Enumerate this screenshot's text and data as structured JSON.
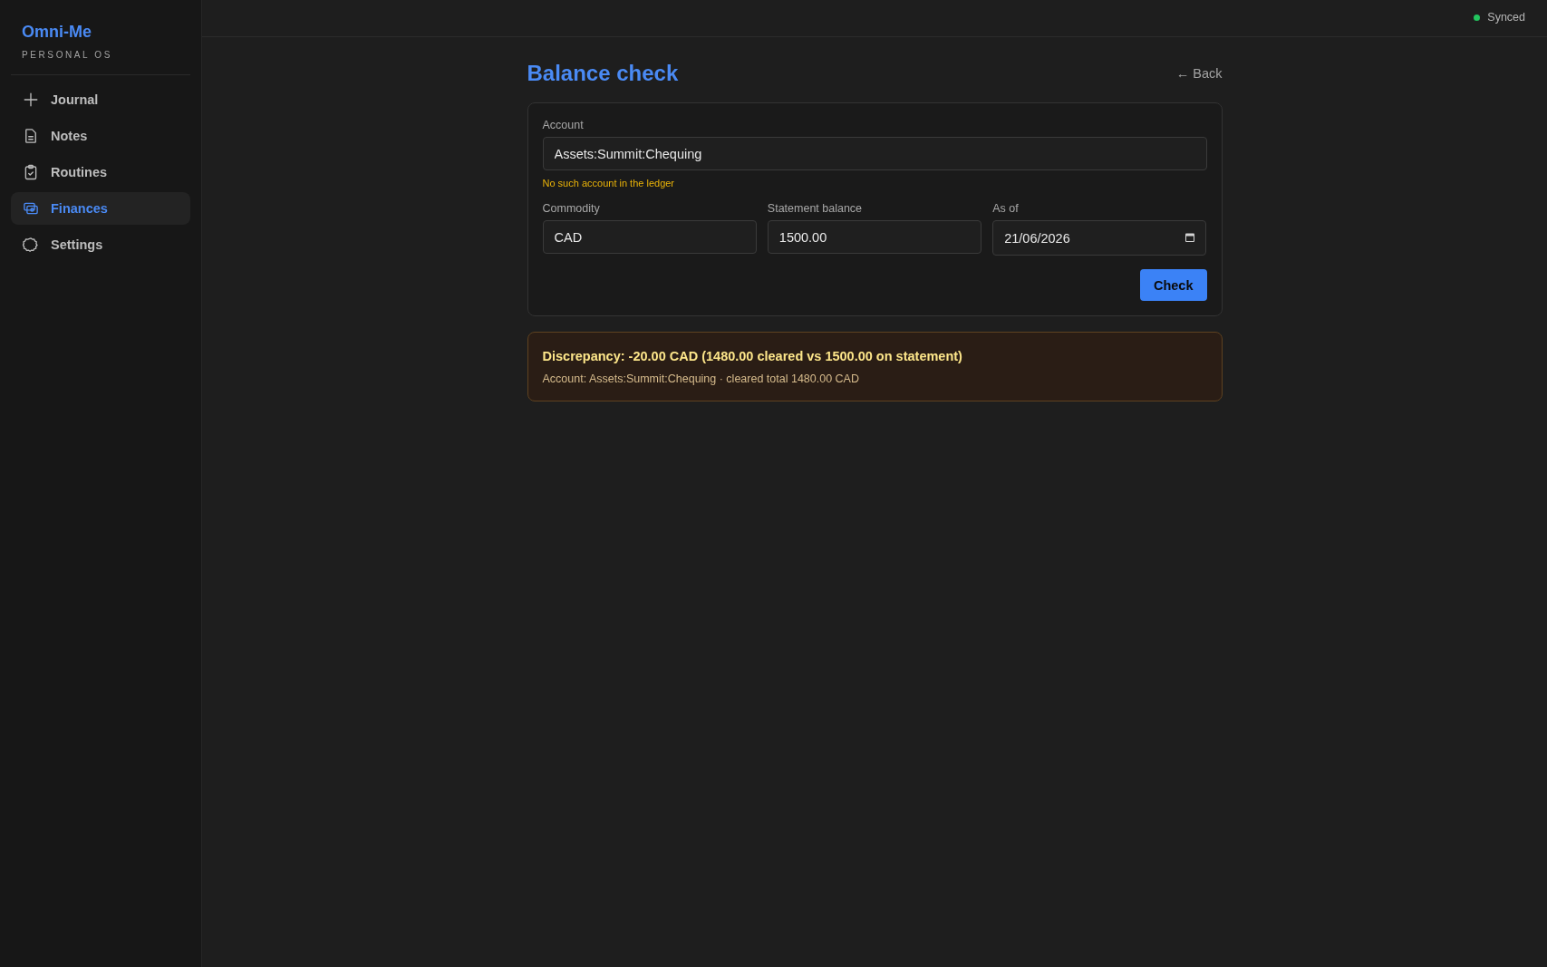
{
  "app": {
    "name": "Omni-Me",
    "tagline": "PERSONAL OS"
  },
  "sidebar": {
    "items": [
      {
        "label": "Journal",
        "selected": false
      },
      {
        "label": "Notes",
        "selected": false
      },
      {
        "label": "Routines",
        "selected": false
      },
      {
        "label": "Finances",
        "selected": true
      },
      {
        "label": "Settings",
        "selected": false
      }
    ]
  },
  "status": {
    "label": "Synced",
    "color": "#22c55e"
  },
  "page": {
    "title": "Balance check",
    "back_link": "← Back"
  },
  "form": {
    "rows": [
      {
        "fields": [
          {
            "kind": "text",
            "label": "Account",
            "value": "Assets:Summit:Chequing",
            "error": "No such account in the ledger"
          }
        ]
      },
      {
        "fields": [
          {
            "kind": "text",
            "label": "Commodity",
            "value": "CAD"
          },
          {
            "kind": "text",
            "label": "Statement balance",
            "value": "1500.00"
          },
          {
            "kind": "date",
            "label": "As of",
            "value": "21/06/2026"
          }
        ]
      }
    ],
    "submit": "Check"
  },
  "result": {
    "kind": "warning",
    "title": "Discrepancy: -20.00 CAD (1480.00 cleared vs 1500.00 on statement)",
    "detail": "Account: Assets:Summit:Chequing · cleared total 1480.00 CAD"
  }
}
